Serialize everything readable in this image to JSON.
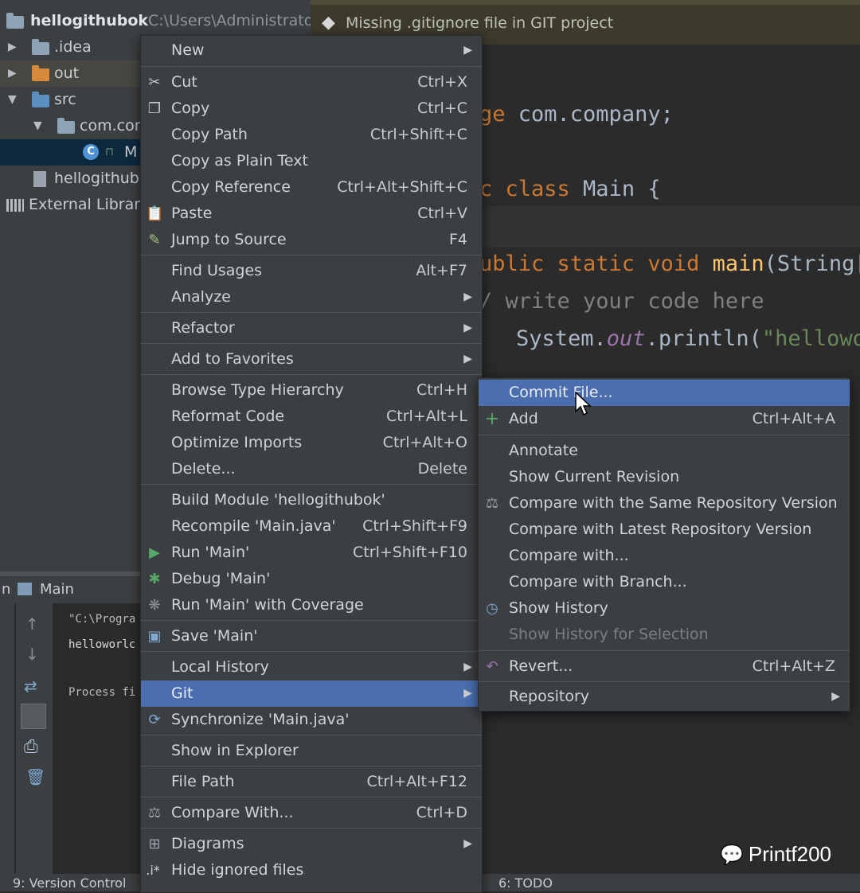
{
  "project_tree": {
    "root_name": "hellogithubok",
    "root_path": "C:\\Users\\Administrato",
    "items": [
      {
        "label": ".idea"
      },
      {
        "label": "out"
      },
      {
        "label": "src"
      },
      {
        "label": "com.con"
      },
      {
        "label": "M"
      },
      {
        "label": "hellogithubo"
      },
      {
        "label": "External Librari"
      }
    ]
  },
  "notification": {
    "text": "Missing .gitignore file in GIT project"
  },
  "editor": {
    "lines": [
      [
        "ge",
        " com.company;"
      ],
      [
        "c class",
        " Main {"
      ],
      [
        "ublic static void",
        "main",
        "(String["
      ],
      [
        "/ write your code here"
      ],
      [
        "System.",
        "out",
        ".println(",
        "\"hellowo"
      ]
    ]
  },
  "run_panel": {
    "tab_label": "Main",
    "tab_prefix": "n",
    "console": [
      "\"C:\\Progra",
      "helloworlc",
      "Process fi"
    ]
  },
  "status_bar": {
    "left": "9: Version Control",
    "right": "6: TODO"
  },
  "context_menu": {
    "items": [
      {
        "label": "New"
      },
      {
        "label": "Cut",
        "shortcut": "Ctrl+X"
      },
      {
        "label": "Copy",
        "shortcut": "Ctrl+C"
      },
      {
        "label": "Copy Path",
        "shortcut": "Ctrl+Shift+C"
      },
      {
        "label": "Copy as Plain Text"
      },
      {
        "label": "Copy Reference",
        "shortcut": "Ctrl+Alt+Shift+C"
      },
      {
        "label": "Paste",
        "shortcut": "Ctrl+V"
      },
      {
        "label": "Jump to Source",
        "shortcut": "F4"
      },
      {
        "label": "Find Usages",
        "shortcut": "Alt+F7"
      },
      {
        "label": "Analyze"
      },
      {
        "label": "Refactor"
      },
      {
        "label": "Add to Favorites"
      },
      {
        "label": "Browse Type Hierarchy",
        "shortcut": "Ctrl+H"
      },
      {
        "label": "Reformat Code",
        "shortcut": "Ctrl+Alt+L"
      },
      {
        "label": "Optimize Imports",
        "shortcut": "Ctrl+Alt+O"
      },
      {
        "label": "Delete...",
        "shortcut": "Delete"
      },
      {
        "label": "Build Module 'hellogithubok'"
      },
      {
        "label": "Recompile 'Main.java'",
        "shortcut": "Ctrl+Shift+F9"
      },
      {
        "label": "Run 'Main'",
        "shortcut": "Ctrl+Shift+F10"
      },
      {
        "label": "Debug 'Main'"
      },
      {
        "label": "Run 'Main' with Coverage"
      },
      {
        "label": "Save 'Main'"
      },
      {
        "label": "Local History"
      },
      {
        "label": "Git"
      },
      {
        "label": "Synchronize 'Main.java'"
      },
      {
        "label": "Show in Explorer"
      },
      {
        "label": "File Path",
        "shortcut": "Ctrl+Alt+F12"
      },
      {
        "label": "Compare With...",
        "shortcut": "Ctrl+D"
      },
      {
        "label": "Diagrams"
      },
      {
        "label": "Hide ignored files"
      }
    ]
  },
  "git_submenu": {
    "items": [
      {
        "label": "Commit File..."
      },
      {
        "label": "Add",
        "shortcut": "Ctrl+Alt+A"
      },
      {
        "label": "Annotate"
      },
      {
        "label": "Show Current Revision"
      },
      {
        "label": "Compare with the Same Repository Version"
      },
      {
        "label": "Compare with Latest Repository Version"
      },
      {
        "label": "Compare with..."
      },
      {
        "label": "Compare with Branch..."
      },
      {
        "label": "Show History"
      },
      {
        "label": "Show History for Selection"
      },
      {
        "label": "Revert...",
        "shortcut": "Ctrl+Alt+Z"
      },
      {
        "label": "Repository"
      }
    ]
  },
  "watermark": {
    "text": "Printf200"
  },
  "colors": {
    "menu_bg": "#3c3f41",
    "highlight": "#4b6eaf",
    "keyword": "#cc7832"
  }
}
